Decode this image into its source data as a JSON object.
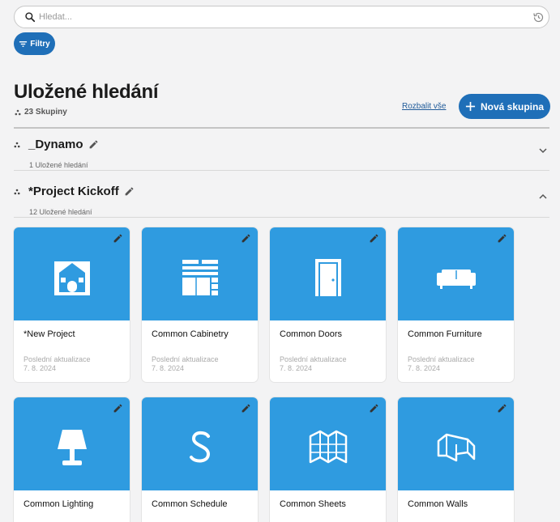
{
  "search": {
    "placeholder": "Hledat..."
  },
  "filters_label": "Filtry",
  "page_title": "Uložené hledání",
  "group_count": "23 Skupiny",
  "expand_all": "Rozbalit vše",
  "new_group": "Nová skupina",
  "groups": [
    {
      "name": "_Dynamo",
      "count": "1 Uložené hledání",
      "expanded": false
    },
    {
      "name": "*Project Kickoff",
      "count": "12 Uložené hledání",
      "expanded": true
    }
  ],
  "cards": [
    {
      "name": "*New Project",
      "updated_label": "Poslední aktualizace",
      "updated_date": "7. 8. 2024",
      "icon": "house-icon"
    },
    {
      "name": "Common Cabinetry",
      "updated_label": "Poslední aktualizace",
      "updated_date": "7. 8. 2024",
      "icon": "cabinet-icon"
    },
    {
      "name": "Common Doors",
      "updated_label": "Poslední aktualizace",
      "updated_date": "7. 8. 2024",
      "icon": "door-icon"
    },
    {
      "name": "Common Furniture",
      "updated_label": "Poslední aktualizace",
      "updated_date": "7. 8. 2024",
      "icon": "sofa-icon"
    },
    {
      "name": "Common Lighting",
      "icon": "lamp-icon"
    },
    {
      "name": "Common Schedule",
      "icon": "schedule-icon"
    },
    {
      "name": "Common Sheets",
      "icon": "sheets-icon"
    },
    {
      "name": "Common Walls",
      "icon": "walls-icon"
    }
  ],
  "colors": {
    "accent": "#1f6fb8",
    "thumb": "#2f9be0",
    "background": "#f3f3f4"
  }
}
